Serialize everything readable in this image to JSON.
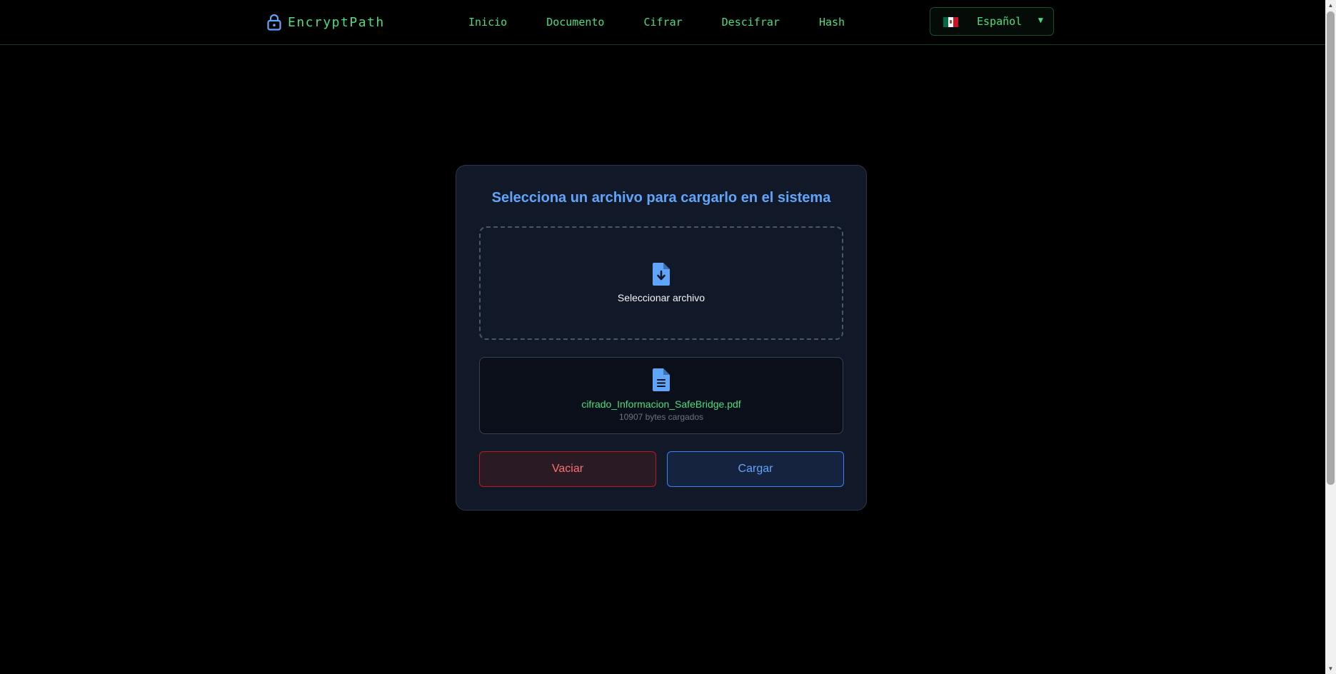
{
  "navbar": {
    "brand": {
      "text": "EncryptPath",
      "icon": "lock-icon"
    },
    "links": [
      {
        "label": "Inicio"
      },
      {
        "label": "Documento"
      },
      {
        "label": "Cifrar"
      },
      {
        "label": "Descifrar"
      },
      {
        "label": "Hash"
      }
    ],
    "language": {
      "label": "Español",
      "flag": "mexico-flag-icon",
      "caret": "▼"
    }
  },
  "upload_card": {
    "title": "Selecciona un archivo para cargarlo en el sistema",
    "dropzone": {
      "label": "Seleccionar archivo",
      "icon": "file-download-icon"
    },
    "file": {
      "icon": "file-document-icon",
      "name": "cifrado_Informacion_SafeBridge.pdf",
      "size_text": "10907 bytes cargados"
    },
    "buttons": {
      "clear_label": "Vaciar",
      "upload_label": "Cargar"
    }
  },
  "colors": {
    "background": "#000000",
    "accent_green": "#4ade80",
    "accent_blue": "#60a5fa",
    "danger_red": "#f87171",
    "card_bg": "#111827"
  }
}
